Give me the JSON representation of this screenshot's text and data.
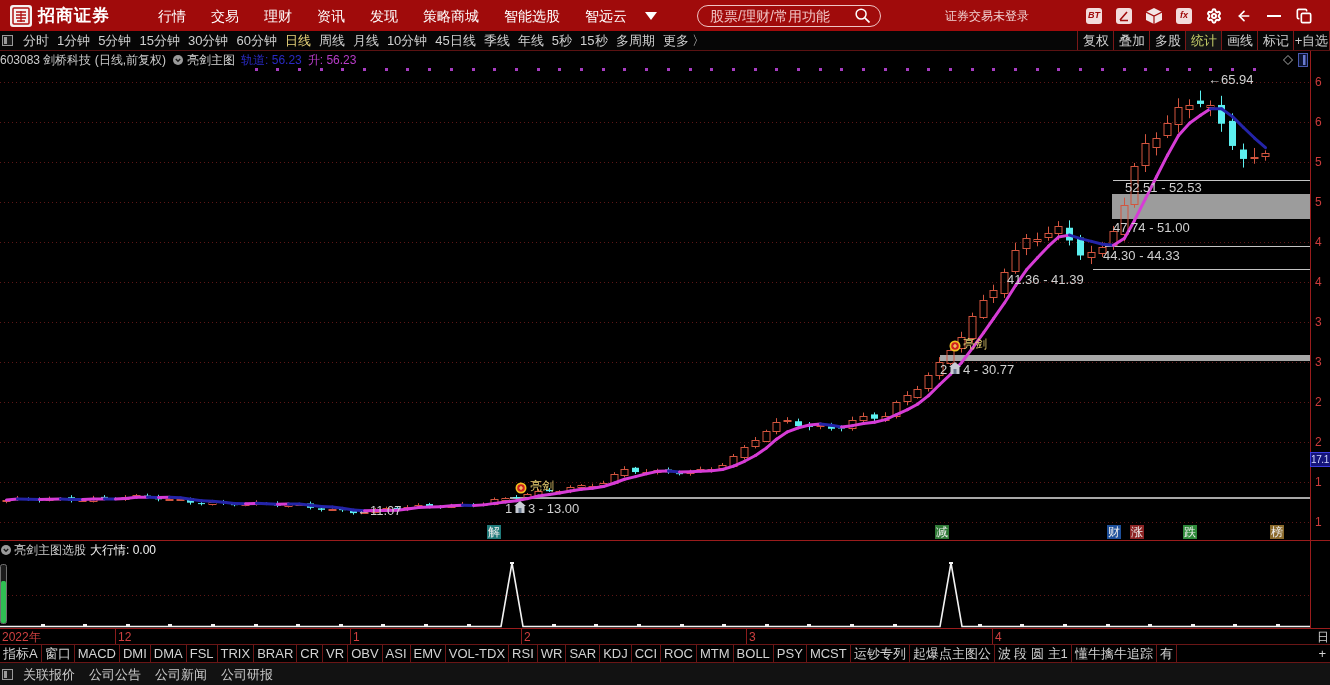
{
  "app_bar": {
    "brand": "招商证券",
    "menu": [
      {
        "label": "行情"
      },
      {
        "label": "交易"
      },
      {
        "label": "理财"
      },
      {
        "label": "资讯"
      },
      {
        "label": "发现"
      },
      {
        "label": "策略商城"
      },
      {
        "label": "智能选股"
      },
      {
        "label": "智远云"
      }
    ],
    "search": {
      "placeholder": "股票/理财/常用功能"
    },
    "login_status": "证券交易未登录",
    "tools": [
      {
        "kind": "text",
        "label": "BT"
      },
      {
        "kind": "pen"
      },
      {
        "kind": "cube"
      },
      {
        "kind": "text",
        "label": "fx"
      },
      {
        "kind": "gear"
      },
      {
        "kind": "back"
      },
      {
        "kind": "minimize"
      },
      {
        "kind": "restore"
      }
    ]
  },
  "period_bar": {
    "periods": [
      {
        "label": "分时",
        "selected": false
      },
      {
        "label": "1分钟",
        "selected": false
      },
      {
        "label": "5分钟",
        "selected": false
      },
      {
        "label": "15分钟",
        "selected": false
      },
      {
        "label": "30分钟",
        "selected": false
      },
      {
        "label": "60分钟",
        "selected": false
      },
      {
        "label": "日线",
        "selected": true
      },
      {
        "label": "周线",
        "selected": false
      },
      {
        "label": "月线",
        "selected": false
      },
      {
        "label": "10分钟",
        "selected": false
      },
      {
        "label": "45日线",
        "selected": false
      },
      {
        "label": "季线",
        "selected": false
      },
      {
        "label": "年线",
        "selected": false
      },
      {
        "label": "5秒",
        "selected": false
      },
      {
        "label": "15秒",
        "selected": false
      },
      {
        "label": "多周期",
        "selected": false
      },
      {
        "label": "更多 〉",
        "selected": false
      }
    ],
    "tools": [
      {
        "label": "复权",
        "selected": false
      },
      {
        "label": "叠加",
        "selected": false
      },
      {
        "label": "多股",
        "selected": false
      },
      {
        "label": "统计",
        "selected": true
      },
      {
        "label": "画线",
        "selected": false
      },
      {
        "label": "标记",
        "selected": false
      },
      {
        "label": "+自选",
        "selected": false
      }
    ]
  },
  "chart_header": {
    "symbol": "603083 剑桥科技 (日线,前复权)",
    "indicator": "亮剑主图",
    "values": [
      {
        "text": "轨道: 56.23",
        "color": "#2a2ac4"
      },
      {
        "text": "升: 56.23",
        "color": "#b83cc8"
      }
    ]
  },
  "price_chart": {
    "high_label": "←65.94",
    "low_label": "←11.07",
    "zones": [
      {
        "text": "52.51 - 52.53"
      },
      {
        "text": "47.74 - 51.00"
      },
      {
        "text": "44.30 - 44.33"
      },
      {
        "text": "41.36 - 41.39"
      }
    ],
    "signals": [
      {
        "tag": "亮剑",
        "parts": [
          "1",
          "3 - 13.00"
        ]
      },
      {
        "tag": "亮剑",
        "parts": [
          "2",
          "4 - 30.77"
        ]
      }
    ],
    "event_badges": [
      {
        "text": "解",
        "color": "#1f7a7a"
      },
      {
        "text": "减",
        "color": "#2f7a36"
      },
      {
        "text": "财",
        "color": "#1d4f9a"
      },
      {
        "text": "涨",
        "color": "#8c2424"
      },
      {
        "text": "跌",
        "color": "#2f8a3a"
      },
      {
        "text": "榜",
        "color": "#8a6a2c"
      }
    ]
  },
  "price_axis": {
    "labels": [
      "6",
      "6",
      "5",
      "5",
      "4",
      "4",
      "3",
      "3",
      "2",
      "2",
      "1",
      "1"
    ],
    "current_price": "17.1"
  },
  "sub_chart": {
    "title": "亮剑主图选股",
    "reading": "大行情: 0.00"
  },
  "date_axis": {
    "labels": [
      "2022年",
      "12",
      "1",
      "2",
      "3",
      "4"
    ],
    "edge_label": "日"
  },
  "indicator_tabs": {
    "tabs": [
      {
        "label": "指标A"
      },
      {
        "label": "窗口"
      },
      {
        "label": "MACD"
      },
      {
        "label": "DMI"
      },
      {
        "label": "DMA"
      },
      {
        "label": "FSL"
      },
      {
        "label": "TRIX"
      },
      {
        "label": "BRAR"
      },
      {
        "label": "CR"
      },
      {
        "label": "VR"
      },
      {
        "label": "OBV"
      },
      {
        "label": "ASI"
      },
      {
        "label": "EMV"
      },
      {
        "label": "VOL-TDX"
      },
      {
        "label": "RSI"
      },
      {
        "label": "WR"
      },
      {
        "label": "SAR"
      },
      {
        "label": "KDJ"
      },
      {
        "label": "CCI"
      },
      {
        "label": "ROC"
      },
      {
        "label": "MTM"
      },
      {
        "label": "BOLL"
      },
      {
        "label": "PSY"
      },
      {
        "label": "MCST"
      },
      {
        "label": "运钞专列"
      },
      {
        "label": "起爆点主图公"
      },
      {
        "label": "波 段 圆 主1"
      },
      {
        "label": "懂牛擒牛追踪"
      },
      {
        "label": "有"
      }
    ],
    "add_label": "+"
  },
  "bottom_bar": {
    "links": [
      "关联报价",
      "公司公告",
      "公司新闻",
      "公司研报"
    ]
  }
}
